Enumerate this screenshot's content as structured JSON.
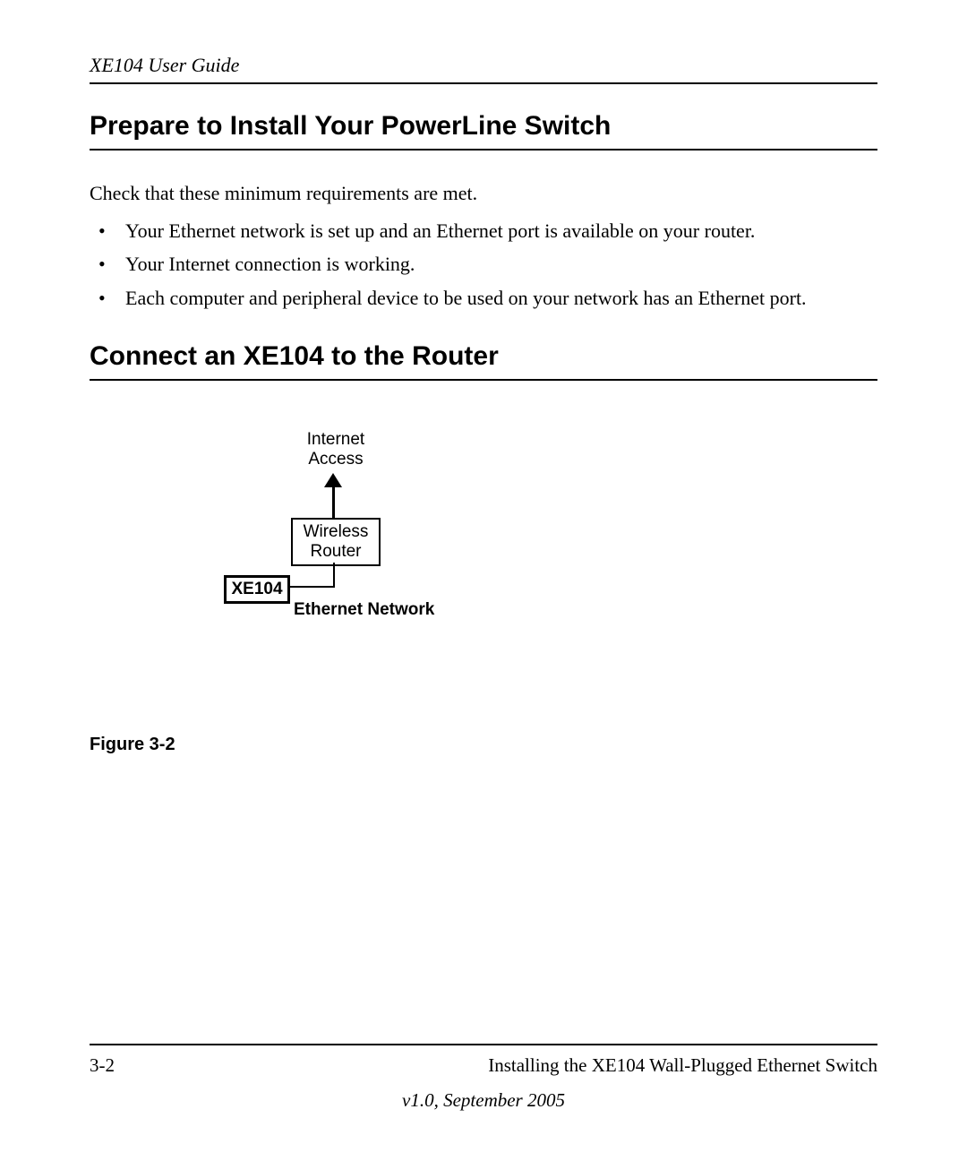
{
  "header": {
    "running_title": "XE104 User Guide"
  },
  "section1": {
    "title": "Prepare to Install Your PowerLine Switch",
    "intro": "Check that these minimum requirements are met.",
    "bullets": [
      "Your Ethernet network is set up and an Ethernet port is available on your router.",
      "Your Internet connection is working.",
      "Each computer and peripheral device to be used on your network has an Ethernet port."
    ]
  },
  "section2": {
    "title": "Connect an XE104 to the Router"
  },
  "diagram": {
    "internet_line1": "Internet",
    "internet_line2": "Access",
    "router_line1": "Wireless",
    "router_line2": "Router",
    "xe_label": "XE104",
    "ethernet_label": "Ethernet Network"
  },
  "figure_caption": "Figure 3-2",
  "footer": {
    "page_number": "3-2",
    "chapter": "Installing the XE104 Wall-Plugged Ethernet Switch",
    "version": "v1.0, September 2005"
  }
}
